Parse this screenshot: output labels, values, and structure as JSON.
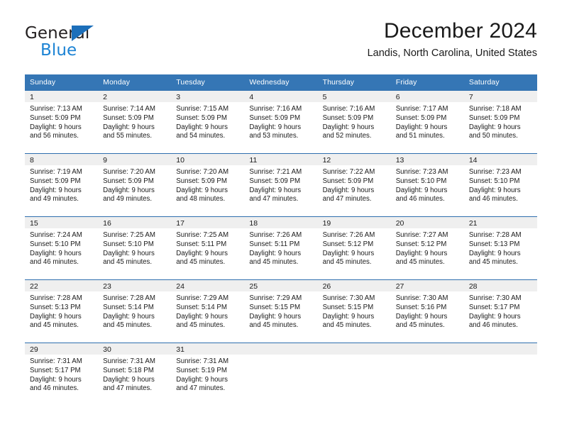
{
  "brand": {
    "name_top": "General",
    "name_bottom": "Blue",
    "accent_color": "#1c83d4",
    "triangle_color": "#1c6fba"
  },
  "header": {
    "title": "December 2024",
    "location": "Landis, North Carolina, United States"
  },
  "theme": {
    "header_bg": "#3576b5",
    "row_border": "#2f6fae",
    "daynum_band_bg": "#efefef",
    "text_color": "#1a1a1a"
  },
  "weekday_headers": [
    "Sunday",
    "Monday",
    "Tuesday",
    "Wednesday",
    "Thursday",
    "Friday",
    "Saturday"
  ],
  "weeks": [
    [
      {
        "day": "1",
        "sunrise": "Sunrise: 7:13 AM",
        "sunset": "Sunset: 5:09 PM",
        "daylight_1": "Daylight: 9 hours",
        "daylight_2": "and 56 minutes."
      },
      {
        "day": "2",
        "sunrise": "Sunrise: 7:14 AM",
        "sunset": "Sunset: 5:09 PM",
        "daylight_1": "Daylight: 9 hours",
        "daylight_2": "and 55 minutes."
      },
      {
        "day": "3",
        "sunrise": "Sunrise: 7:15 AM",
        "sunset": "Sunset: 5:09 PM",
        "daylight_1": "Daylight: 9 hours",
        "daylight_2": "and 54 minutes."
      },
      {
        "day": "4",
        "sunrise": "Sunrise: 7:16 AM",
        "sunset": "Sunset: 5:09 PM",
        "daylight_1": "Daylight: 9 hours",
        "daylight_2": "and 53 minutes."
      },
      {
        "day": "5",
        "sunrise": "Sunrise: 7:16 AM",
        "sunset": "Sunset: 5:09 PM",
        "daylight_1": "Daylight: 9 hours",
        "daylight_2": "and 52 minutes."
      },
      {
        "day": "6",
        "sunrise": "Sunrise: 7:17 AM",
        "sunset": "Sunset: 5:09 PM",
        "daylight_1": "Daylight: 9 hours",
        "daylight_2": "and 51 minutes."
      },
      {
        "day": "7",
        "sunrise": "Sunrise: 7:18 AM",
        "sunset": "Sunset: 5:09 PM",
        "daylight_1": "Daylight: 9 hours",
        "daylight_2": "and 50 minutes."
      }
    ],
    [
      {
        "day": "8",
        "sunrise": "Sunrise: 7:19 AM",
        "sunset": "Sunset: 5:09 PM",
        "daylight_1": "Daylight: 9 hours",
        "daylight_2": "and 49 minutes."
      },
      {
        "day": "9",
        "sunrise": "Sunrise: 7:20 AM",
        "sunset": "Sunset: 5:09 PM",
        "daylight_1": "Daylight: 9 hours",
        "daylight_2": "and 49 minutes."
      },
      {
        "day": "10",
        "sunrise": "Sunrise: 7:20 AM",
        "sunset": "Sunset: 5:09 PM",
        "daylight_1": "Daylight: 9 hours",
        "daylight_2": "and 48 minutes."
      },
      {
        "day": "11",
        "sunrise": "Sunrise: 7:21 AM",
        "sunset": "Sunset: 5:09 PM",
        "daylight_1": "Daylight: 9 hours",
        "daylight_2": "and 47 minutes."
      },
      {
        "day": "12",
        "sunrise": "Sunrise: 7:22 AM",
        "sunset": "Sunset: 5:09 PM",
        "daylight_1": "Daylight: 9 hours",
        "daylight_2": "and 47 minutes."
      },
      {
        "day": "13",
        "sunrise": "Sunrise: 7:23 AM",
        "sunset": "Sunset: 5:10 PM",
        "daylight_1": "Daylight: 9 hours",
        "daylight_2": "and 46 minutes."
      },
      {
        "day": "14",
        "sunrise": "Sunrise: 7:23 AM",
        "sunset": "Sunset: 5:10 PM",
        "daylight_1": "Daylight: 9 hours",
        "daylight_2": "and 46 minutes."
      }
    ],
    [
      {
        "day": "15",
        "sunrise": "Sunrise: 7:24 AM",
        "sunset": "Sunset: 5:10 PM",
        "daylight_1": "Daylight: 9 hours",
        "daylight_2": "and 46 minutes."
      },
      {
        "day": "16",
        "sunrise": "Sunrise: 7:25 AM",
        "sunset": "Sunset: 5:10 PM",
        "daylight_1": "Daylight: 9 hours",
        "daylight_2": "and 45 minutes."
      },
      {
        "day": "17",
        "sunrise": "Sunrise: 7:25 AM",
        "sunset": "Sunset: 5:11 PM",
        "daylight_1": "Daylight: 9 hours",
        "daylight_2": "and 45 minutes."
      },
      {
        "day": "18",
        "sunrise": "Sunrise: 7:26 AM",
        "sunset": "Sunset: 5:11 PM",
        "daylight_1": "Daylight: 9 hours",
        "daylight_2": "and 45 minutes."
      },
      {
        "day": "19",
        "sunrise": "Sunrise: 7:26 AM",
        "sunset": "Sunset: 5:12 PM",
        "daylight_1": "Daylight: 9 hours",
        "daylight_2": "and 45 minutes."
      },
      {
        "day": "20",
        "sunrise": "Sunrise: 7:27 AM",
        "sunset": "Sunset: 5:12 PM",
        "daylight_1": "Daylight: 9 hours",
        "daylight_2": "and 45 minutes."
      },
      {
        "day": "21",
        "sunrise": "Sunrise: 7:28 AM",
        "sunset": "Sunset: 5:13 PM",
        "daylight_1": "Daylight: 9 hours",
        "daylight_2": "and 45 minutes."
      }
    ],
    [
      {
        "day": "22",
        "sunrise": "Sunrise: 7:28 AM",
        "sunset": "Sunset: 5:13 PM",
        "daylight_1": "Daylight: 9 hours",
        "daylight_2": "and 45 minutes."
      },
      {
        "day": "23",
        "sunrise": "Sunrise: 7:28 AM",
        "sunset": "Sunset: 5:14 PM",
        "daylight_1": "Daylight: 9 hours",
        "daylight_2": "and 45 minutes."
      },
      {
        "day": "24",
        "sunrise": "Sunrise: 7:29 AM",
        "sunset": "Sunset: 5:14 PM",
        "daylight_1": "Daylight: 9 hours",
        "daylight_2": "and 45 minutes."
      },
      {
        "day": "25",
        "sunrise": "Sunrise: 7:29 AM",
        "sunset": "Sunset: 5:15 PM",
        "daylight_1": "Daylight: 9 hours",
        "daylight_2": "and 45 minutes."
      },
      {
        "day": "26",
        "sunrise": "Sunrise: 7:30 AM",
        "sunset": "Sunset: 5:15 PM",
        "daylight_1": "Daylight: 9 hours",
        "daylight_2": "and 45 minutes."
      },
      {
        "day": "27",
        "sunrise": "Sunrise: 7:30 AM",
        "sunset": "Sunset: 5:16 PM",
        "daylight_1": "Daylight: 9 hours",
        "daylight_2": "and 45 minutes."
      },
      {
        "day": "28",
        "sunrise": "Sunrise: 7:30 AM",
        "sunset": "Sunset: 5:17 PM",
        "daylight_1": "Daylight: 9 hours",
        "daylight_2": "and 46 minutes."
      }
    ],
    [
      {
        "day": "29",
        "sunrise": "Sunrise: 7:31 AM",
        "sunset": "Sunset: 5:17 PM",
        "daylight_1": "Daylight: 9 hours",
        "daylight_2": "and 46 minutes."
      },
      {
        "day": "30",
        "sunrise": "Sunrise: 7:31 AM",
        "sunset": "Sunset: 5:18 PM",
        "daylight_1": "Daylight: 9 hours",
        "daylight_2": "and 47 minutes."
      },
      {
        "day": "31",
        "sunrise": "Sunrise: 7:31 AM",
        "sunset": "Sunset: 5:19 PM",
        "daylight_1": "Daylight: 9 hours",
        "daylight_2": "and 47 minutes."
      },
      {
        "day": "",
        "sunrise": "",
        "sunset": "",
        "daylight_1": "",
        "daylight_2": ""
      },
      {
        "day": "",
        "sunrise": "",
        "sunset": "",
        "daylight_1": "",
        "daylight_2": ""
      },
      {
        "day": "",
        "sunrise": "",
        "sunset": "",
        "daylight_1": "",
        "daylight_2": ""
      },
      {
        "day": "",
        "sunrise": "",
        "sunset": "",
        "daylight_1": "",
        "daylight_2": ""
      }
    ]
  ]
}
